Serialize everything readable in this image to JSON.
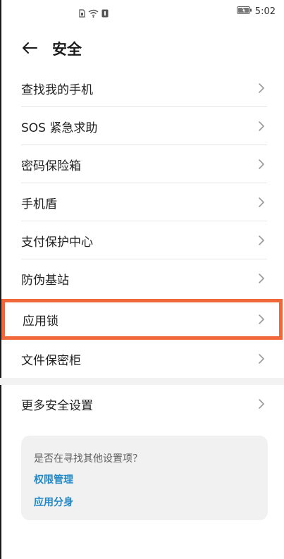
{
  "status_bar": {
    "time": "5:02"
  },
  "header": {
    "title": "安全"
  },
  "settings": {
    "items": [
      {
        "label": "查找我的手机"
      },
      {
        "label": "SOS 紧急求助"
      },
      {
        "label": "密码保险箱"
      },
      {
        "label": "手机盾"
      },
      {
        "label": "支付保护中心"
      },
      {
        "label": "防伪基站"
      },
      {
        "label": "应用锁",
        "highlighted": true
      },
      {
        "label": "文件保密柜"
      }
    ],
    "more": {
      "label": "更多安全设置"
    }
  },
  "suggestion": {
    "question": "是否在寻找其他设置项？",
    "links": [
      {
        "label": "权限管理"
      },
      {
        "label": "应用分身"
      }
    ]
  },
  "colors": {
    "highlight_border": "#f0683a",
    "link": "#1e88c7"
  }
}
